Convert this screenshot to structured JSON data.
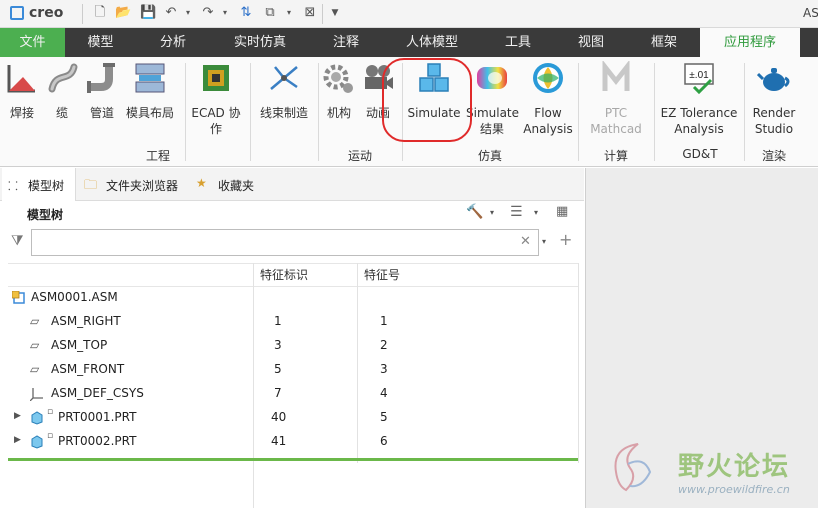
{
  "titlebar": {
    "logo": "creo",
    "title_fragment": "AS"
  },
  "tabs": [
    "文件",
    "模型",
    "分析",
    "实时仿真",
    "注释",
    "人体模型",
    "工具",
    "视图",
    "框架",
    "应用程序"
  ],
  "active_tab": "应用程序",
  "ribbon": {
    "buttons": {
      "weld": "焊接",
      "cable": "缆",
      "piping": "管道",
      "mold": "模具布局",
      "ecad": "ECAD 协作",
      "harness": "线束制造",
      "mechanism": "机构",
      "animation": "动画",
      "simulate": "Simulate",
      "simulate_results": "Simulate结果",
      "flow": "Flow Analysis",
      "mathcad": "PTC Mathcad",
      "ez_tolerance": "EZ Tolerance Analysis",
      "render": "Render Studio"
    },
    "groups": {
      "engineering": "工程",
      "motion": "运动",
      "simulation": "仿真",
      "calc": "计算",
      "gdt": "GD&T",
      "render": "渲染"
    }
  },
  "nav": {
    "tab_model_tree": "模型树",
    "tab_folder_browser": "文件夹浏览器",
    "tab_favorites": "收藏夹",
    "panel_title": "模型树",
    "search_placeholder": ""
  },
  "table": {
    "headers": [
      "特征标识",
      "特征号"
    ],
    "root": "ASM0001.ASM",
    "rows": [
      {
        "name": "ASM_RIGHT",
        "id": "1",
        "num": "1"
      },
      {
        "name": "ASM_TOP",
        "id": "3",
        "num": "2"
      },
      {
        "name": "ASM_FRONT",
        "id": "5",
        "num": "3"
      },
      {
        "name": "ASM_DEF_CSYS",
        "id": "7",
        "num": "4"
      },
      {
        "name": "PRT0001.PRT",
        "id": "40",
        "num": "5"
      },
      {
        "name": "PRT0002.PRT",
        "id": "41",
        "num": "6"
      }
    ]
  },
  "watermark": {
    "name": "野火论坛",
    "url": "www.proewildfire.cn"
  },
  "colors": {
    "active_tab": "#4caf50",
    "tabbar": "#3a3a3a",
    "highlight_circle": "#e02a2a"
  }
}
